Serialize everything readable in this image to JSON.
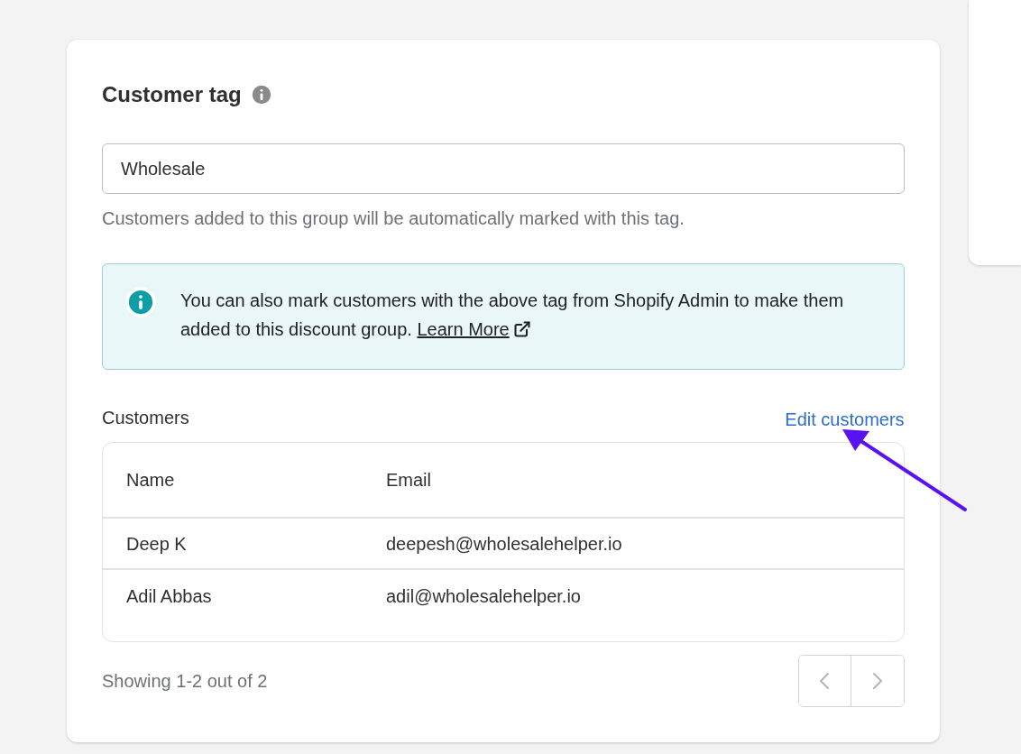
{
  "section": {
    "title": "Customer tag"
  },
  "tag_field": {
    "value": "Wholesale",
    "help": "Customers added to this group will be automatically marked with this tag."
  },
  "banner": {
    "text": "You can also mark customers with the above tag from Shopify Admin to make them added to this discount group.",
    "link": "Learn More"
  },
  "customers": {
    "label": "Customers",
    "edit_link": "Edit customers",
    "table": {
      "columns": [
        "Name",
        "Email"
      ],
      "rows": [
        [
          "Deep K",
          "deepesh@wholesalehelper.io"
        ],
        [
          "Adil Abbas",
          "adil@wholesalehelper.io"
        ]
      ]
    }
  },
  "pagination": {
    "summary": "Showing 1-2 out of 2",
    "previous": {
      "disabled": true
    },
    "next": {
      "disabled": true
    }
  }
}
